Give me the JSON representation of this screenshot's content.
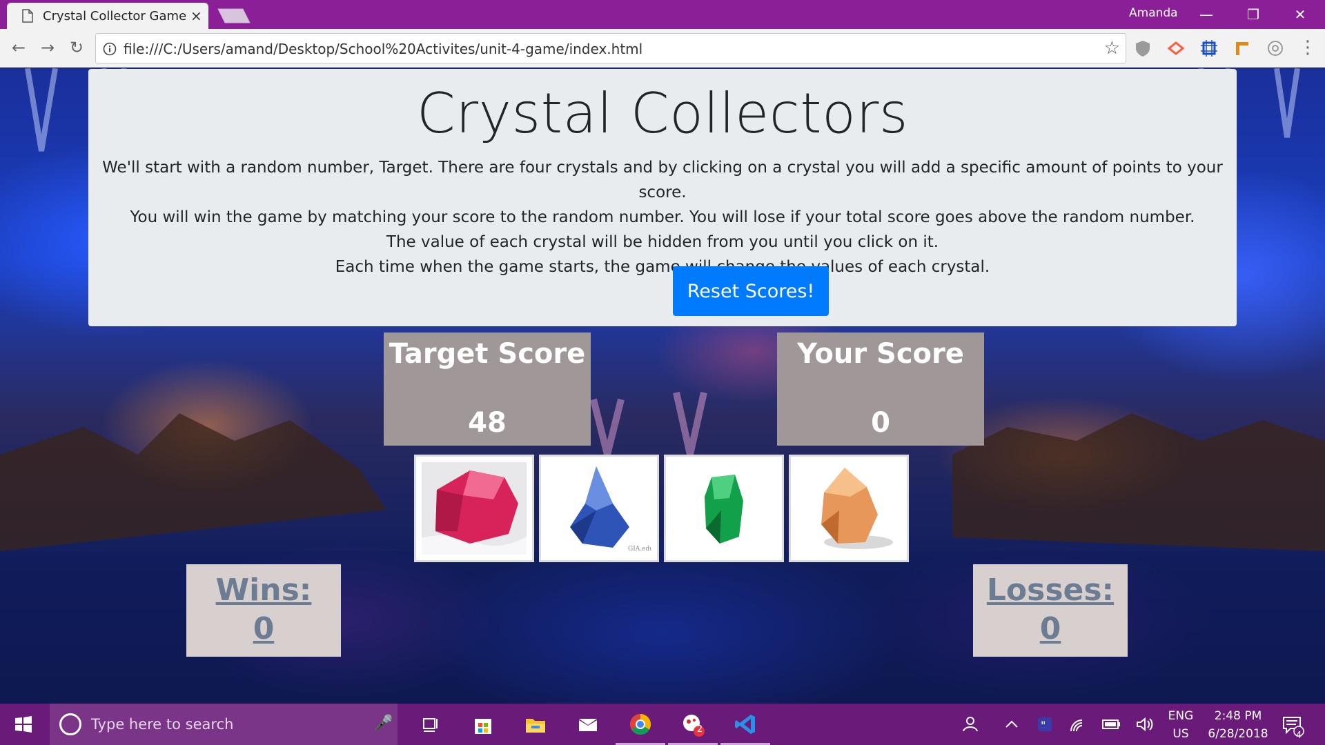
{
  "browser": {
    "tab_title": "Crystal Collector Game",
    "tab_close": "×",
    "user": "Amanda",
    "url": "file:///C:/Users/amand/Desktop/School%20Activites/unit-4-game/index.html",
    "back_icon": "arrow-left-icon",
    "forward_icon": "arrow-right-icon",
    "reload_icon": "reload-icon",
    "star_icon": "star-icon"
  },
  "game": {
    "title": "Crystal Collectors",
    "instructions": [
      "We'll start with a random number, Target. There are four crystals and by clicking on a crystal you will add a specific amount of points to your score.",
      "You will win the game by matching your score to the random number. You will lose if your total score goes above the random number.",
      "The value of each crystal will be hidden from you until you click on it.",
      "Each time when the game starts, the game will change the values of each crystal."
    ],
    "reset_label": "Reset Scores!",
    "target_label": "Target Score",
    "target_value": "48",
    "your_label": "Your Score",
    "your_value": "0",
    "wins_label": "Wins:",
    "wins_value": "0",
    "losses_label": "Losses:",
    "losses_value": "0",
    "crystals": [
      {
        "name": "red-crystal",
        "color": "#d8225a"
      },
      {
        "name": "blue-crystal",
        "color": "#2e54b8",
        "caption": "GIA.edu"
      },
      {
        "name": "green-crystal",
        "color": "#12a04a"
      },
      {
        "name": "orange-crystal",
        "color": "#e8975a"
      }
    ]
  },
  "taskbar": {
    "search_placeholder": "Type here to search",
    "lang_top": "ENG",
    "lang_bottom": "US",
    "time": "2:48 PM",
    "date": "6/28/2018",
    "notification_count": "4",
    "badge_count": "2"
  }
}
